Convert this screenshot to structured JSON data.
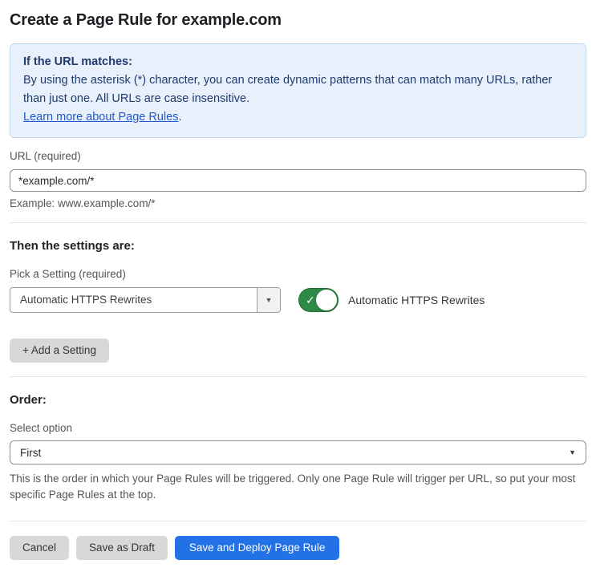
{
  "page": {
    "title": "Create a Page Rule for example.com"
  },
  "info_box": {
    "heading": "If the URL matches:",
    "body": "By using the asterisk (*) character, you can create dynamic patterns that can match many URLs, rather than just one. All URLs are case insensitive.",
    "link_label": "Learn more about Page Rules",
    "link_suffix": "."
  },
  "url_field": {
    "label": "URL (required)",
    "value": "*example.com/*",
    "helper": "Example: www.example.com/*"
  },
  "settings_section": {
    "heading": "Then the settings are:",
    "picker_label": "Pick a Setting (required)",
    "picker_value": "Automatic HTTPS Rewrites",
    "toggle_state": "on",
    "toggle_check_glyph": "✓",
    "toggle_label": "Automatic HTTPS Rewrites",
    "add_setting_label": "+ Add a Setting",
    "dropdown_arrow_glyph": "▼"
  },
  "order_section": {
    "heading": "Order:",
    "select_label": "Select option",
    "select_value": "First",
    "select_arrow_glyph": "▼",
    "description": "This is the order in which your Page Rules will be triggered. Only one Page Rule will trigger per URL, so put your most specific Page Rules at the top."
  },
  "footer": {
    "cancel_label": "Cancel",
    "save_draft_label": "Save as Draft",
    "save_deploy_label": "Save and Deploy Page Rule"
  },
  "colors": {
    "accent_blue": "#2271e5",
    "info_box_bg": "#e8f1fb",
    "info_box_border": "#bfd9f2",
    "info_box_text": "#1e3a6e",
    "link_blue": "#2158ce",
    "toggle_green": "#2d8a46",
    "gray_button_bg": "#d8d8da",
    "divider": "#e4e4e7"
  }
}
